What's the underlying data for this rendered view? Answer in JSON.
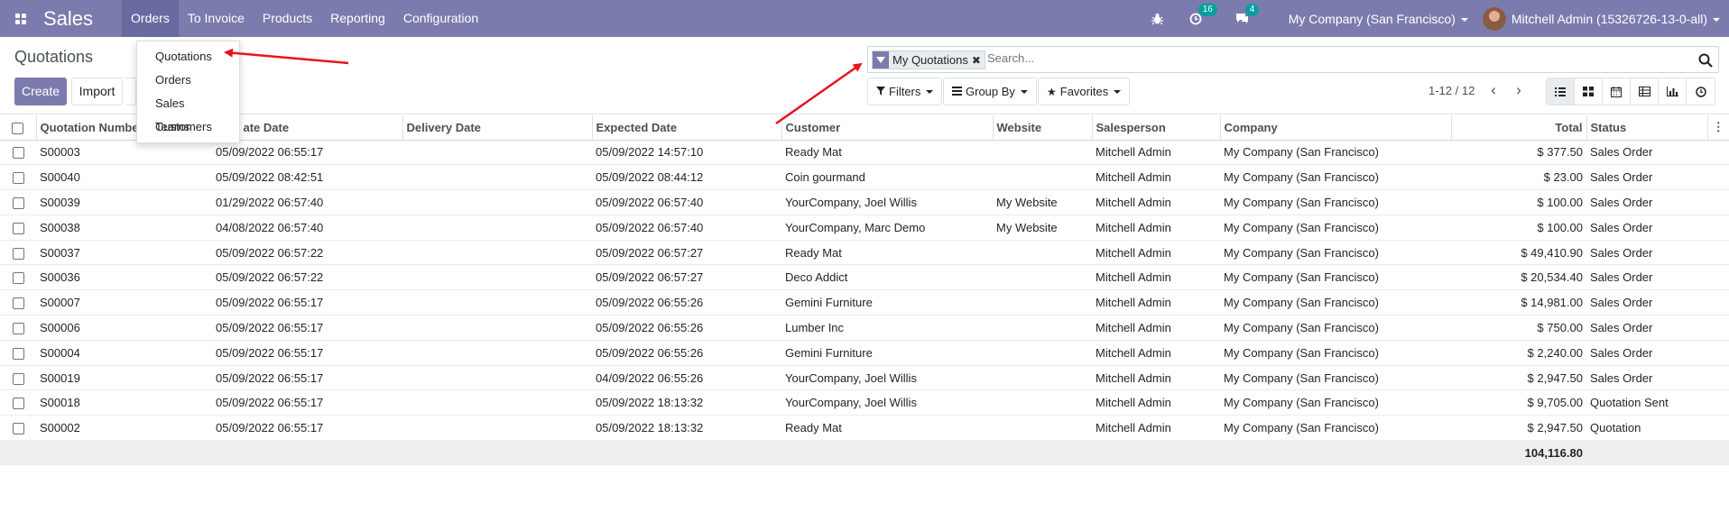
{
  "topbar": {
    "app_title": "Sales",
    "menu": [
      "Orders",
      "To Invoice",
      "Products",
      "Reporting",
      "Configuration"
    ],
    "activities_count": "16",
    "messages_count": "4",
    "company": "My Company (San Francisco)",
    "user": "Mitchell Admin (15326726-13-0-all)"
  },
  "orders_dropdown": [
    "Quotations",
    "Orders",
    "Sales Teams",
    "Customers"
  ],
  "control": {
    "page_title": "Quotations",
    "create_label": "Create",
    "import_label": "Import",
    "facet_label": "My Quotations",
    "search_placeholder": "Search...",
    "filters_label": "Filters",
    "groupby_label": "Group By",
    "favorites_label": "Favorites",
    "pager": "1-12 / 12"
  },
  "table": {
    "columns": [
      "Quotation Number",
      "Creation Date",
      "Delivery Date",
      "Expected Date",
      "Customer",
      "Website",
      "Salesperson",
      "Company",
      "Total",
      "Status"
    ],
    "header_shown": [
      "Quotation Numbe",
      "ate Date",
      "Delivery Date",
      "Expected Date",
      "Customer",
      "Website",
      "Salesperson",
      "Company",
      "Total",
      "Status"
    ],
    "rows": [
      {
        "number": "S00003",
        "creation": "05/09/2022 06:55:17",
        "delivery": "",
        "expected": "05/09/2022 14:57:10",
        "customer": "Ready Mat",
        "website": "",
        "salesperson": "Mitchell Admin",
        "company": "My Company (San Francisco)",
        "total": "$ 377.50",
        "status": "Sales Order"
      },
      {
        "number": "S00040",
        "creation": "05/09/2022 08:42:51",
        "delivery": "",
        "expected": "05/09/2022 08:44:12",
        "customer": "Coin gourmand",
        "website": "",
        "salesperson": "Mitchell Admin",
        "company": "My Company (San Francisco)",
        "total": "$ 23.00",
        "status": "Sales Order"
      },
      {
        "number": "S00039",
        "creation": "01/29/2022 06:57:40",
        "delivery": "",
        "expected": "05/09/2022 06:57:40",
        "customer": "YourCompany, Joel Willis",
        "website": "My Website",
        "salesperson": "Mitchell Admin",
        "company": "My Company (San Francisco)",
        "total": "$ 100.00",
        "status": "Sales Order"
      },
      {
        "number": "S00038",
        "creation": "04/08/2022 06:57:40",
        "delivery": "",
        "expected": "05/09/2022 06:57:40",
        "customer": "YourCompany, Marc Demo",
        "website": "My Website",
        "salesperson": "Mitchell Admin",
        "company": "My Company (San Francisco)",
        "total": "$ 100.00",
        "status": "Sales Order"
      },
      {
        "number": "S00037",
        "creation": "05/09/2022 06:57:22",
        "delivery": "",
        "expected": "05/09/2022 06:57:27",
        "customer": "Ready Mat",
        "website": "",
        "salesperson": "Mitchell Admin",
        "company": "My Company (San Francisco)",
        "total": "$ 49,410.90",
        "status": "Sales Order"
      },
      {
        "number": "S00036",
        "creation": "05/09/2022 06:57:22",
        "delivery": "",
        "expected": "05/09/2022 06:57:27",
        "customer": "Deco Addict",
        "website": "",
        "salesperson": "Mitchell Admin",
        "company": "My Company (San Francisco)",
        "total": "$ 20,534.40",
        "status": "Sales Order"
      },
      {
        "number": "S00007",
        "creation": "05/09/2022 06:55:17",
        "delivery": "",
        "expected": "05/09/2022 06:55:26",
        "customer": "Gemini Furniture",
        "website": "",
        "salesperson": "Mitchell Admin",
        "company": "My Company (San Francisco)",
        "total": "$ 14,981.00",
        "status": "Sales Order"
      },
      {
        "number": "S00006",
        "creation": "05/09/2022 06:55:17",
        "delivery": "",
        "expected": "05/09/2022 06:55:26",
        "customer": "Lumber Inc",
        "website": "",
        "salesperson": "Mitchell Admin",
        "company": "My Company (San Francisco)",
        "total": "$ 750.00",
        "status": "Sales Order"
      },
      {
        "number": "S00004",
        "creation": "05/09/2022 06:55:17",
        "delivery": "",
        "expected": "05/09/2022 06:55:26",
        "customer": "Gemini Furniture",
        "website": "",
        "salesperson": "Mitchell Admin",
        "company": "My Company (San Francisco)",
        "total": "$ 2,240.00",
        "status": "Sales Order"
      },
      {
        "number": "S00019",
        "creation": "05/09/2022 06:55:17",
        "delivery": "",
        "expected": "04/09/2022 06:55:26",
        "customer": "YourCompany, Joel Willis",
        "website": "",
        "salesperson": "Mitchell Admin",
        "company": "My Company (San Francisco)",
        "total": "$ 2,947.50",
        "status": "Sales Order"
      },
      {
        "number": "S00018",
        "creation": "05/09/2022 06:55:17",
        "delivery": "",
        "expected": "05/09/2022 18:13:32",
        "customer": "YourCompany, Joel Willis",
        "website": "",
        "salesperson": "Mitchell Admin",
        "company": "My Company (San Francisco)",
        "total": "$ 9,705.00",
        "status": "Quotation Sent"
      },
      {
        "number": "S00002",
        "creation": "05/09/2022 06:55:17",
        "delivery": "",
        "expected": "05/09/2022 18:13:32",
        "customer": "Ready Mat",
        "website": "",
        "salesperson": "Mitchell Admin",
        "company": "My Company (San Francisco)",
        "total": "$ 2,947.50",
        "status": "Quotation"
      }
    ],
    "grand_total": "104,116.80"
  },
  "colors": {
    "brand": "#7c7bad",
    "badge": "#00a09d",
    "annotation_arrow": "#e8141b"
  }
}
